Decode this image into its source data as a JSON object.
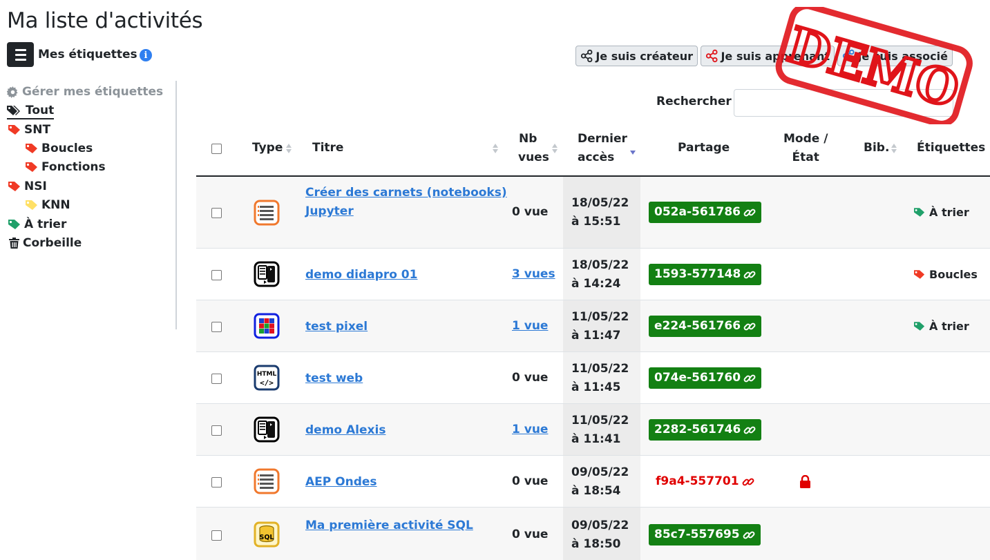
{
  "page": {
    "title": "Ma liste d'activités"
  },
  "labels_header": {
    "text": "Mes étiquettes"
  },
  "sidebar": {
    "manage": "Gérer mes étiquettes",
    "items": [
      {
        "label": "Tout",
        "color": "#212529"
      },
      {
        "label": "SNT",
        "color": "#f03a25"
      },
      {
        "label": "Boucles",
        "color": "#f03a25"
      },
      {
        "label": "Fonctions",
        "color": "#f03a25"
      },
      {
        "label": "NSI",
        "color": "#f03a25"
      },
      {
        "label": "KNN",
        "color": "#ffe066"
      },
      {
        "label": "À trier",
        "color": "#20a06a"
      },
      {
        "label": "Corbeille",
        "color": "#212529"
      }
    ]
  },
  "roles": {
    "creator": "Je suis créateur",
    "learner": "Je suis apprenant",
    "associate": "Je suis associé"
  },
  "search": {
    "label": "Rechercher",
    "value": ""
  },
  "table": {
    "headers": {
      "type": "Type",
      "title": "Titre",
      "views_1": "Nb",
      "views_2": "vues",
      "last_1": "Dernier",
      "last_2": "accès",
      "share": "Partage",
      "mode_1": "Mode /",
      "mode_2": "État",
      "bib": "Bib.",
      "labels": "Étiquettes"
    },
    "rows": [
      {
        "icon": "notebook-icon",
        "title_1": "Créer des carnets (notebooks)",
        "title_2": "Jupyter",
        "views": "0 vue",
        "date": "18/05/22",
        "time": "à 15:51",
        "share": "052a-561786",
        "label": "À trier"
      },
      {
        "icon": "python-ide-icon",
        "title_1": "demo didapro 01",
        "views": "3 vues",
        "date": "18/05/22",
        "time": "à 14:24",
        "share": "1593-577148",
        "label": "Boucles"
      },
      {
        "icon": "pixel-grid-icon",
        "title_1": "test pixel",
        "views": "1 vue",
        "date": "11/05/22",
        "time": "à 11:47",
        "share": "e224-561766",
        "label": "À trier"
      },
      {
        "icon": "html-icon",
        "title_1": "test web",
        "views": "0 vue",
        "date": "11/05/22",
        "time": "à 11:45",
        "share": "074e-561760"
      },
      {
        "icon": "python-ide-icon",
        "title_1": "demo Alexis",
        "views": "1 vue",
        "date": "11/05/22",
        "time": "à 11:41",
        "share": "2282-561746"
      },
      {
        "icon": "notebook-icon",
        "title_1": "AEP Ondes",
        "views": "0 vue",
        "date": "09/05/22",
        "time": "à 18:54",
        "share": "f9a4-557701"
      },
      {
        "icon": "sql-icon",
        "title_1": "Ma première activité SQL",
        "views": "0 vue",
        "date": "09/05/22",
        "time": "à 18:50",
        "share": "85c7-557695"
      }
    ]
  },
  "stamp": {
    "text": "DEMO",
    "color": "#e0141a"
  },
  "colors": {
    "link": "#2c79d5",
    "share_ok": "#138013",
    "share_locked": "#e00000"
  }
}
